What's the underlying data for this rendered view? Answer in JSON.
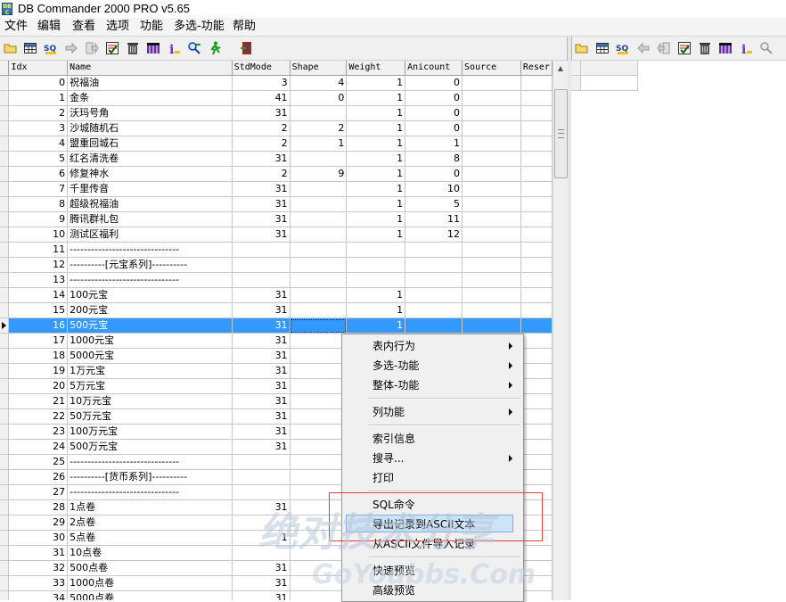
{
  "window": {
    "title": "DB Commander 2000 PRO v5.65",
    "icon_text": "DB C"
  },
  "menubar": [
    "文件",
    "编辑",
    "查看",
    "选项",
    "功能",
    "多选-功能",
    "帮助"
  ],
  "toolbar": {
    "left_icons": [
      "open-folder-icon",
      "grid-view-icon",
      "sql-icon",
      "arrow-right-icon",
      "export-icon",
      "filter-icon",
      "delete-icon",
      "columns-icon",
      "info-icon",
      "find-icon",
      "run-icon",
      "exit-icon"
    ],
    "right_icons": [
      "open-folder-icon",
      "grid-view-icon",
      "sql-icon",
      "arrow-left-icon",
      "import-icon",
      "filter-icon",
      "delete-icon",
      "columns-icon",
      "info-icon",
      "find-icon"
    ]
  },
  "table": {
    "columns": [
      "Idx",
      "Name",
      "StdMode",
      "Shape",
      "Weight",
      "Anicount",
      "Source",
      "Reser"
    ],
    "rows": [
      [
        "0",
        "祝福油",
        "3",
        "4",
        "1",
        "0",
        "",
        ""
      ],
      [
        "1",
        "金条",
        "41",
        "0",
        "1",
        "0",
        "",
        ""
      ],
      [
        "2",
        "沃玛号角",
        "31",
        "",
        "1",
        "0",
        "",
        ""
      ],
      [
        "3",
        "沙城随机石",
        "2",
        "2",
        "1",
        "0",
        "",
        ""
      ],
      [
        "4",
        "盟重回城石",
        "2",
        "1",
        "1",
        "1",
        "",
        ""
      ],
      [
        "5",
        "红名清洗卷",
        "31",
        "",
        "1",
        "8",
        "",
        ""
      ],
      [
        "6",
        "修复神水",
        "2",
        "9",
        "1",
        "0",
        "",
        ""
      ],
      [
        "7",
        "千里传音",
        "31",
        "",
        "1",
        "10",
        "",
        ""
      ],
      [
        "8",
        "超级祝福油",
        "31",
        "",
        "1",
        "5",
        "",
        ""
      ],
      [
        "9",
        "腾讯群礼包",
        "31",
        "",
        "1",
        "11",
        "",
        ""
      ],
      [
        "10",
        "测试区福利",
        "31",
        "",
        "1",
        "12",
        "",
        ""
      ],
      [
        "11",
        "-------------------------------",
        "",
        "",
        "",
        "",
        "",
        ""
      ],
      [
        "12",
        "----------[元宝系列]----------",
        "",
        "",
        "",
        "",
        "",
        ""
      ],
      [
        "13",
        "-------------------------------",
        "",
        "",
        "",
        "",
        "",
        ""
      ],
      [
        "14",
        "100元宝",
        "31",
        "",
        "1",
        "",
        "",
        ""
      ],
      [
        "15",
        "200元宝",
        "31",
        "",
        "1",
        "",
        "",
        ""
      ],
      [
        "16",
        "500元宝",
        "31",
        "",
        "1",
        "",
        "",
        ""
      ],
      [
        "17",
        "1000元宝",
        "31",
        "",
        "",
        "",
        "",
        ""
      ],
      [
        "18",
        "5000元宝",
        "31",
        "",
        "",
        "",
        "",
        ""
      ],
      [
        "19",
        "1万元宝",
        "31",
        "",
        "",
        "",
        "",
        ""
      ],
      [
        "20",
        "5万元宝",
        "31",
        "",
        "",
        "",
        "",
        ""
      ],
      [
        "21",
        "10万元宝",
        "31",
        "",
        "",
        "",
        "",
        ""
      ],
      [
        "22",
        "50万元宝",
        "31",
        "",
        "",
        "",
        "",
        ""
      ],
      [
        "23",
        "100万元宝",
        "31",
        "",
        "",
        "",
        "",
        ""
      ],
      [
        "24",
        "500万元宝",
        "31",
        "",
        "",
        "",
        "",
        ""
      ],
      [
        "25",
        "-------------------------------",
        "",
        "",
        "",
        "",
        "",
        ""
      ],
      [
        "26",
        "----------[货币系列]----------",
        "",
        "",
        "",
        "",
        "",
        ""
      ],
      [
        "27",
        "-------------------------------",
        "",
        "",
        "",
        "",
        "",
        ""
      ],
      [
        "28",
        "1点卷",
        "31",
        "",
        "",
        "",
        "",
        ""
      ],
      [
        "29",
        "2点卷",
        "",
        "",
        "",
        "",
        "",
        ""
      ],
      [
        "30",
        "5点卷",
        "1",
        "",
        "",
        "",
        "",
        ""
      ],
      [
        "31",
        "10点卷",
        "",
        "",
        "",
        "",
        "",
        ""
      ],
      [
        "32",
        "500点卷",
        "31",
        "",
        "",
        "",
        "",
        ""
      ],
      [
        "33",
        "1000点卷",
        "31",
        "",
        "",
        "",
        "",
        ""
      ],
      [
        "34",
        "5000点卷",
        "31",
        "",
        "",
        "",
        "",
        ""
      ]
    ],
    "selected_index": 16
  },
  "context_menu": {
    "items": [
      {
        "label": "表内行为",
        "submenu": true
      },
      {
        "label": "多选-功能",
        "submenu": true
      },
      {
        "label": "整体-功能",
        "submenu": true
      },
      {
        "label": "列功能",
        "submenu": true
      },
      {
        "label": "索引信息",
        "submenu": false
      },
      {
        "label": "搜寻...",
        "submenu": true
      },
      {
        "label": "打印",
        "submenu": false
      },
      {
        "label": "SQL命令",
        "submenu": false
      },
      {
        "label": "导出记录到ASCII文本",
        "submenu": false
      },
      {
        "label": "从ASCII文件导入记录",
        "submenu": false
      },
      {
        "label": "快速预览",
        "submenu": false
      },
      {
        "label": "高级预览",
        "submenu": false
      }
    ]
  },
  "watermark": {
    "text": "绝对技术分享",
    "url": "GoYoubbs.Com"
  },
  "colors": {
    "selection": "#3399ff",
    "highlight": "#cde3f7",
    "annotation": "#e04040"
  }
}
